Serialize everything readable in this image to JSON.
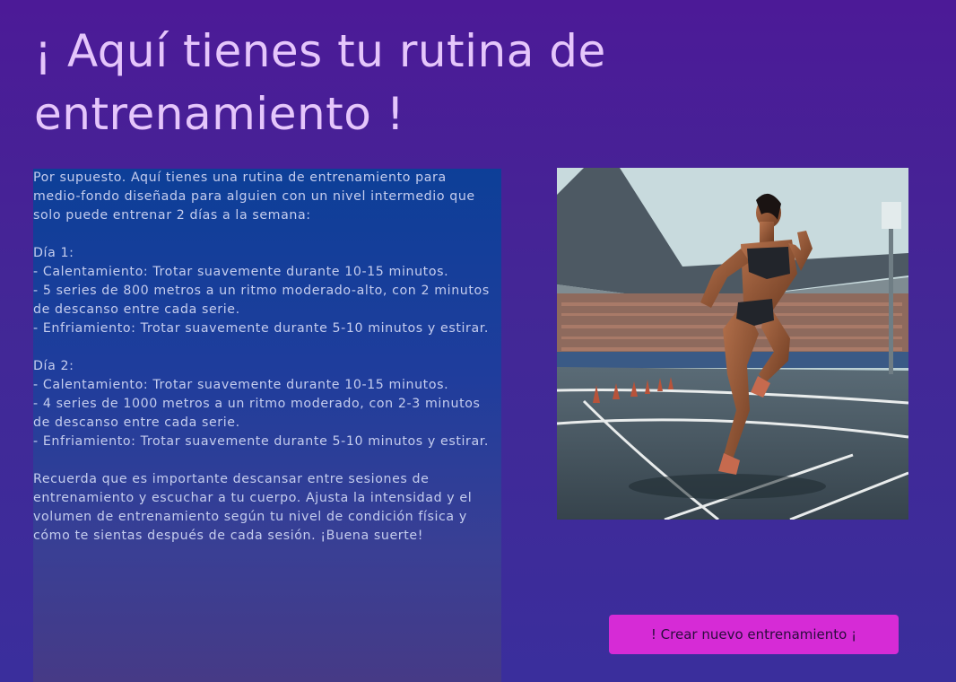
{
  "page": {
    "title": "¡ Aquí tienes tu rutina de entrenamiento !"
  },
  "routine": {
    "text": "Por supuesto. Aquí tienes una rutina de entrenamiento para medio-fondo diseñada para alguien con un nivel intermedio que solo puede entrenar 2 días a la semana:\n\nDía 1:\n- Calentamiento: Trotar suavemente durante 10-15 minutos.\n- 5 series de 800 metros a un ritmo moderado-alto, con 2 minutos de descanso entre cada serie.\n- Enfriamiento: Trotar suavemente durante 5-10 minutos y estirar.\n\nDía 2:\n- Calentamiento: Trotar suavemente durante 10-15 minutos.\n- 4 series de 1000 metros a un ritmo moderado, con 2-3 minutos de descanso entre cada serie.\n- Enfriamiento: Trotar suavemente durante 5-10 minutos y estirar.\n\nRecuerda que es importante descansar entre sesiones de entrenamiento y escuchar a tu cuerpo. Ajusta la intensidad y el volumen de entrenamiento según tu nivel de condición física y cómo te sientas después de cada sesión. ¡Buena suerte!"
  },
  "actions": {
    "new_workout_label": "! Crear nuevo entrenamiento ¡"
  },
  "colors": {
    "background": "#4a1e97",
    "title": "#e5c6fb",
    "panel_top": "#0d3f98",
    "panel_bottom": "#463a86",
    "button": "#d62bd6"
  }
}
